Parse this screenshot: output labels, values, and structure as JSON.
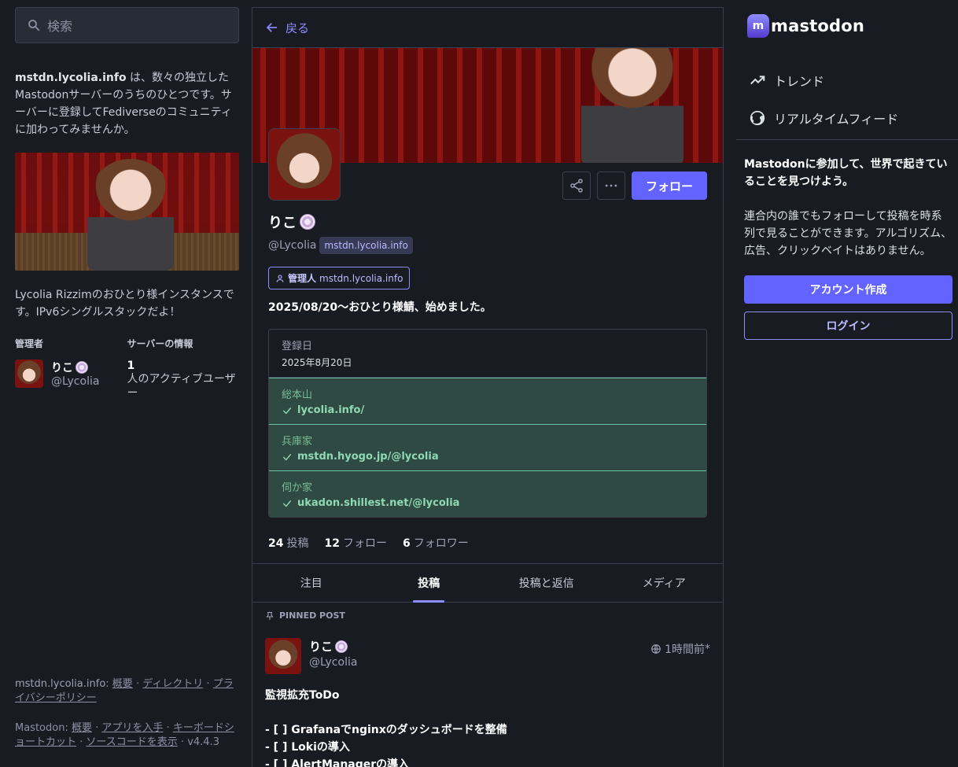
{
  "search": {
    "placeholder": "検索"
  },
  "server_about": {
    "domain": "mstdn.lycolia.info",
    "text": " は、数々の独立したMastodonサーバーのうちのひとつです。サーバーに登録してFediverseのコミュニティに加わってみませんか。"
  },
  "server_blurb": "Lycolia Rizzimのおひとり様インスタンスです。IPv6シングルスタックだよ！",
  "admin_section": {
    "heading": "管理者",
    "name": "りこ",
    "handle": "@Lycolia"
  },
  "server_info": {
    "heading": "サーバーの情報",
    "count": "1",
    "label": "人のアクティブユーザー"
  },
  "left_footer": {
    "site": "mstdn.lycolia.info",
    "sep": ": ",
    "links1": [
      "概要",
      "ディレクトリ",
      "プライバシーポリシー"
    ],
    "mastodon": "Mastodon",
    "links2": [
      "概要",
      "アプリを入手",
      "キーボードショートカット",
      "ソースコードを表示"
    ],
    "version": "v4.4.3"
  },
  "header": {
    "back_label": "戻る"
  },
  "profile": {
    "display_name": "りこ",
    "username": "@Lycolia",
    "domain": "mstdn.lycolia.info",
    "role_label": "管理人",
    "role_domain": "mstdn.lycolia.info",
    "bio": "2025/08/20〜おひとり様鯖、始めました。",
    "follow_label": "フォロー",
    "joined_label": "登録日",
    "joined_date": "2025年8月20日",
    "fields": [
      {
        "name": "総本山",
        "value": "lycolia.info/"
      },
      {
        "name": "兵庫家",
        "value": "mstdn.hyogo.jp/@lycolia"
      },
      {
        "name": "伺か家",
        "value": "ukadon.shillest.net/@lycolia"
      }
    ],
    "counts": {
      "posts_n": "24",
      "posts_label": "投稿",
      "following_n": "12",
      "following_label": "フォロー",
      "followers_n": "6",
      "followers_label": "フォロワー"
    }
  },
  "tabs": [
    {
      "label": "注目",
      "active": false
    },
    {
      "label": "投稿",
      "active": true
    },
    {
      "label": "投稿と返信",
      "active": false
    },
    {
      "label": "メディア",
      "active": false
    }
  ],
  "pinned_label": "PINNED POST",
  "post": {
    "name": "りこ",
    "handle": "@Lycolia",
    "time": "1時間前",
    "edited_mark": "*",
    "body": "監視拡充ToDo\n\n- [ ] Grafanaでnginxのダッシュボードを整備\n- [ ] Lokiの導入\n- [ ] AlertManagerの導入"
  },
  "brand": {
    "name": "mastodon"
  },
  "nav": [
    {
      "label": "トレンド",
      "icon": "trending-icon"
    },
    {
      "label": "リアルタイムフィード",
      "icon": "globe-icon"
    }
  ],
  "signup": {
    "heading": "Mastodonに参加して、世界で起きていることを見つけよう。",
    "text": "連合内の誰でもフォローして投稿を時系列で見ることができます。アルゴリズム、広告、クリックベイトはありません。",
    "create_label": "アカウント作成",
    "login_label": "ログイン"
  },
  "colors": {
    "accent": "#6364ff",
    "link": "#8c8dff",
    "bg": "#191b22",
    "verified": "#79bd9a"
  }
}
